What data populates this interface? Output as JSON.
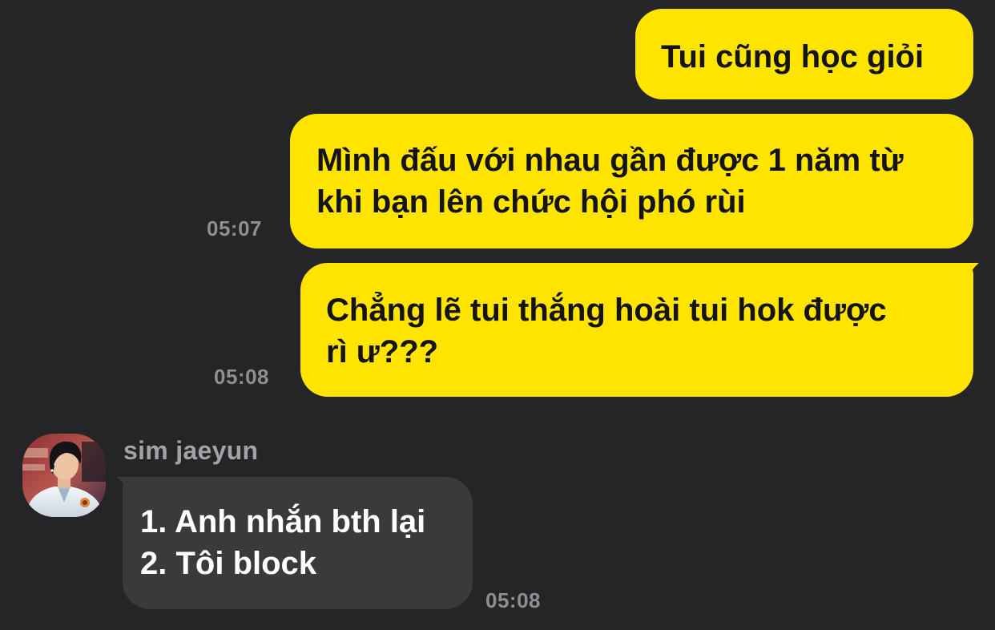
{
  "colors": {
    "background": "#252527",
    "outgoing_bubble": "#FFE400",
    "incoming_bubble": "#3A3A3C",
    "timestamp": "#8E8E93",
    "sender_name": "#A2A2A7"
  },
  "messages": [
    {
      "direction": "outgoing",
      "text": "Tui cũng học giỏi",
      "time": ""
    },
    {
      "direction": "outgoing",
      "text": "Mình đấu với nhau gần được 1 năm từ\nkhi bạn lên chức hội phó rùi",
      "time": "05:07"
    },
    {
      "direction": "outgoing",
      "text": "Chẳng lẽ tui thắng hoài tui hok được\nrì ư???",
      "time": "05:08"
    },
    {
      "direction": "incoming",
      "sender": "sim jaeyun",
      "avatar_icon": "profile-photo-avatar",
      "text": "1. Anh nhắn bth lại\n2. Tôi block",
      "time": "05:08"
    }
  ]
}
